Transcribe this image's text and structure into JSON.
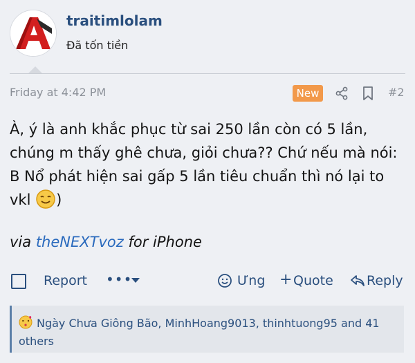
{
  "user": {
    "username": "traitimlolam",
    "title": "Đã tốn tiền"
  },
  "meta": {
    "date": "Friday at 4:42 PM",
    "badge": "New",
    "post_number": "#2"
  },
  "message": {
    "text": "À, ý là anh khắc phục từ sai 250 lần còn có 5 lần, chúng m thấy ghê chưa, giỏi chưa?? Chứ nếu mà nói: B Nổ phát hiện sai gấp 5 lần tiêu chuẩn thì nó lại to vkl",
    "closing": ")",
    "via_prefix": "via",
    "via_link": "theNEXTvoz",
    "via_suffix": "for iPhone"
  },
  "actions": {
    "report": "Report",
    "more": "•••",
    "react": "Ưng",
    "quote": "Quote",
    "quote_prefix": "+",
    "reply": "Reply"
  },
  "reactions": {
    "text": "Ngày Chưa Giông Bão, MinhHoang9013, thinhtuong95 and 41 others"
  },
  "colors": {
    "background": "#eef0f4",
    "link": "#2a4f7e",
    "badge": "#f2994a",
    "reaction_bar": "#e3e6eb"
  },
  "icons": [
    "autocad-avatar",
    "share-icon",
    "bookmark-icon",
    "checkbox-icon",
    "chevron-down-icon",
    "react-icon",
    "reply-icon",
    "kiss-emoji",
    "smile-emoji"
  ]
}
